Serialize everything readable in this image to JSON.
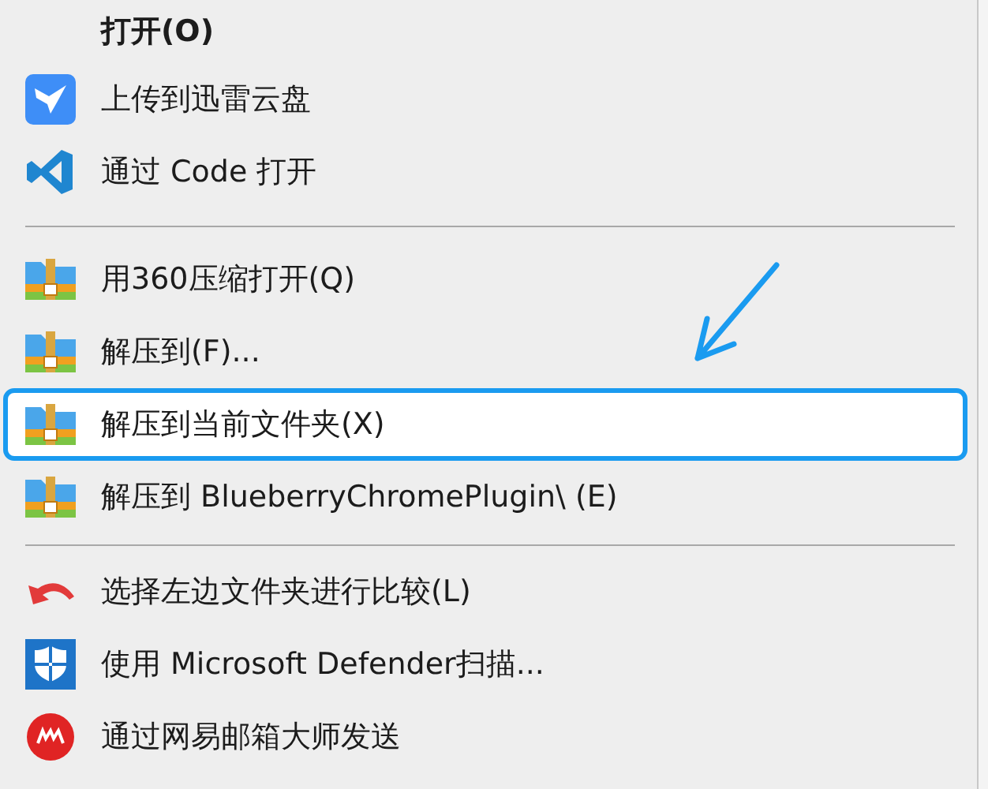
{
  "menu": {
    "sections": [
      {
        "items": [
          {
            "label": "打开(O)",
            "bold": true,
            "highlighted": false
          },
          {
            "label": "上传到迅雷云盘",
            "bold": false,
            "highlighted": false
          },
          {
            "label": "通过 Code 打开",
            "bold": false,
            "highlighted": false
          }
        ]
      },
      {
        "items": [
          {
            "label": "用360压缩打开(Q)",
            "bold": false,
            "highlighted": false
          },
          {
            "label": "解压到(F)...",
            "bold": false,
            "highlighted": false
          },
          {
            "label": "解压到当前文件夹(X)",
            "bold": false,
            "highlighted": true
          },
          {
            "label": "解压到 BlueberryChromePlugin\\ (E)",
            "bold": false,
            "highlighted": false
          }
        ]
      },
      {
        "items": [
          {
            "label": "选择左边文件夹进行比较(L)",
            "bold": false,
            "highlighted": false
          },
          {
            "label": "使用 Microsoft Defender扫描...",
            "bold": false,
            "highlighted": false
          },
          {
            "label": "通过网易邮箱大师发送",
            "bold": false,
            "highlighted": false
          }
        ]
      }
    ]
  }
}
